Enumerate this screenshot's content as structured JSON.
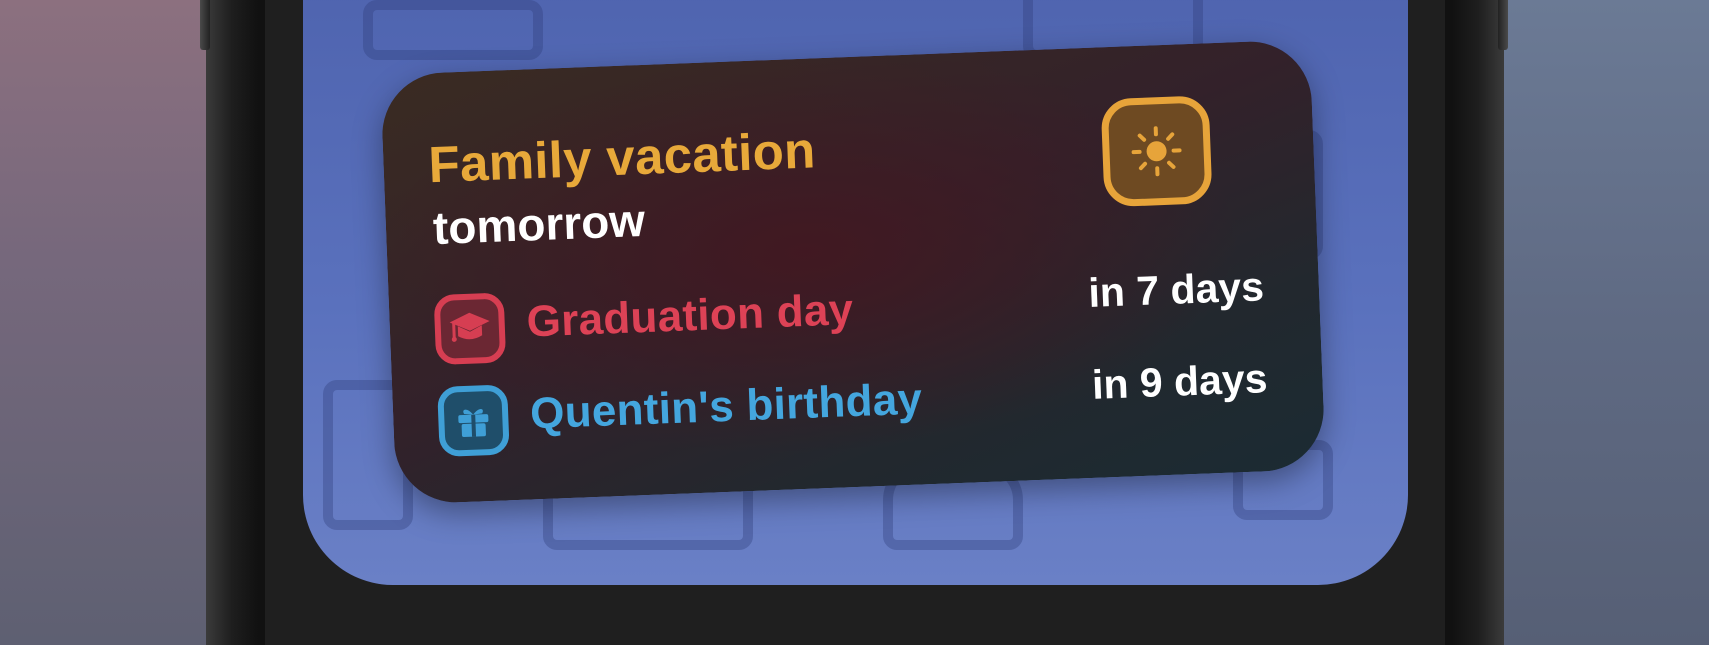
{
  "widget": {
    "title": "Family vacation",
    "subtitle": "tomorrow",
    "badge_icon": "sun-icon",
    "accent_color": "#e8a93a"
  },
  "events": [
    {
      "icon": "graduation-cap-icon",
      "label": "Graduation day",
      "when": "in 7 days",
      "color": "#dd4256"
    },
    {
      "icon": "gift-icon",
      "label": "Quentin's birthday",
      "when": "in 9 days",
      "color": "#44a6de"
    }
  ]
}
